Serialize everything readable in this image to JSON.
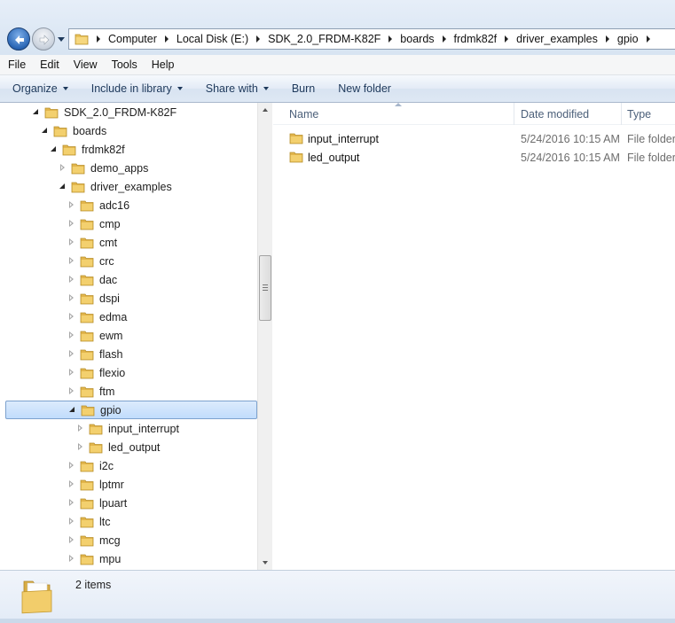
{
  "breadcrumbs": [
    "Computer",
    "Local Disk (E:)",
    "SDK_2.0_FRDM-K82F",
    "boards",
    "frdmk82f",
    "driver_examples",
    "gpio"
  ],
  "menu": [
    "File",
    "Edit",
    "View",
    "Tools",
    "Help"
  ],
  "toolbar": {
    "organize": "Organize",
    "include_in_library": "Include in library",
    "share_with": "Share with",
    "burn": "Burn",
    "new_folder": "New folder"
  },
  "tree": [
    {
      "label": "SDK_2.0_FRDM-K82F",
      "depth": 3,
      "expanded": true
    },
    {
      "label": "boards",
      "depth": 4,
      "expanded": true
    },
    {
      "label": "frdmk82f",
      "depth": 5,
      "expanded": true
    },
    {
      "label": "demo_apps",
      "depth": 6,
      "expanded": false
    },
    {
      "label": "driver_examples",
      "depth": 6,
      "expanded": true
    },
    {
      "label": "adc16",
      "depth": 7,
      "expanded": false
    },
    {
      "label": "cmp",
      "depth": 7,
      "expanded": false
    },
    {
      "label": "cmt",
      "depth": 7,
      "expanded": false
    },
    {
      "label": "crc",
      "depth": 7,
      "expanded": false
    },
    {
      "label": "dac",
      "depth": 7,
      "expanded": false
    },
    {
      "label": "dspi",
      "depth": 7,
      "expanded": false
    },
    {
      "label": "edma",
      "depth": 7,
      "expanded": false
    },
    {
      "label": "ewm",
      "depth": 7,
      "expanded": false
    },
    {
      "label": "flash",
      "depth": 7,
      "expanded": false
    },
    {
      "label": "flexio",
      "depth": 7,
      "expanded": false
    },
    {
      "label": "ftm",
      "depth": 7,
      "expanded": false
    },
    {
      "label": "gpio",
      "depth": 7,
      "expanded": true,
      "selected": true
    },
    {
      "label": "input_interrupt",
      "depth": 8,
      "expanded": false
    },
    {
      "label": "led_output",
      "depth": 8,
      "expanded": false
    },
    {
      "label": "i2c",
      "depth": 7,
      "expanded": false
    },
    {
      "label": "lptmr",
      "depth": 7,
      "expanded": false
    },
    {
      "label": "lpuart",
      "depth": 7,
      "expanded": false
    },
    {
      "label": "ltc",
      "depth": 7,
      "expanded": false
    },
    {
      "label": "mcg",
      "depth": 7,
      "expanded": false
    },
    {
      "label": "mpu",
      "depth": 7,
      "expanded": false
    }
  ],
  "columns": {
    "name": "Name",
    "date_modified": "Date modified",
    "type": "Type"
  },
  "files": [
    {
      "name": "input_interrupt",
      "date": "5/24/2016 10:15 AM",
      "type": "File folder"
    },
    {
      "name": "led_output",
      "date": "5/24/2016 10:15 AM",
      "type": "File folder"
    }
  ],
  "status": {
    "item_count": "2 items"
  },
  "icons": {
    "back": "back-arrow-icon",
    "forward": "forward-arrow-icon",
    "folder": "folder-icon"
  },
  "colors": {
    "folder": "#e9c25a",
    "selection": "#c1dcfc",
    "toolbar_text": "#1e395b"
  }
}
